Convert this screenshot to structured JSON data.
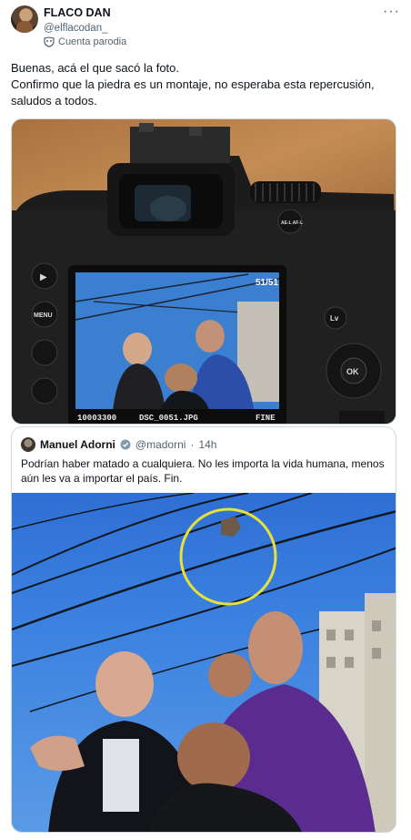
{
  "tweet": {
    "author_name": "FLACO DAN",
    "author_handle": "@elflacodan_",
    "badge_label": "Cuenta parodia",
    "more_icon": "more-dots-icon",
    "text_lines": [
      "Buenas, acá el que sacó la foto.",
      "Confirmo que la piedra es un montaje, no esperaba esta repercusión,",
      "saludos a todos."
    ]
  },
  "camera_photo": {
    "lcd_counter": "51/51",
    "lcd_file_left": "10003300",
    "lcd_file_mid": "DSC_0051.JPG",
    "lcd_quality": "FINE",
    "btn_play": "▶",
    "btn_menu": "MENU",
    "btn_lv": "Lv",
    "btn_ok": "OK",
    "btn_ae": "AE-L AF-L"
  },
  "quoted_tweet": {
    "author_name": "Manuel Adorni",
    "author_handle": "@madorni",
    "separator": "·",
    "time": "14h",
    "text_lines": [
      "Podrían haber matado a cualquiera. No les importa la vida humana, menos",
      "aún les va a importar el país. Fin."
    ],
    "highlight_color": "#e8e13a"
  }
}
